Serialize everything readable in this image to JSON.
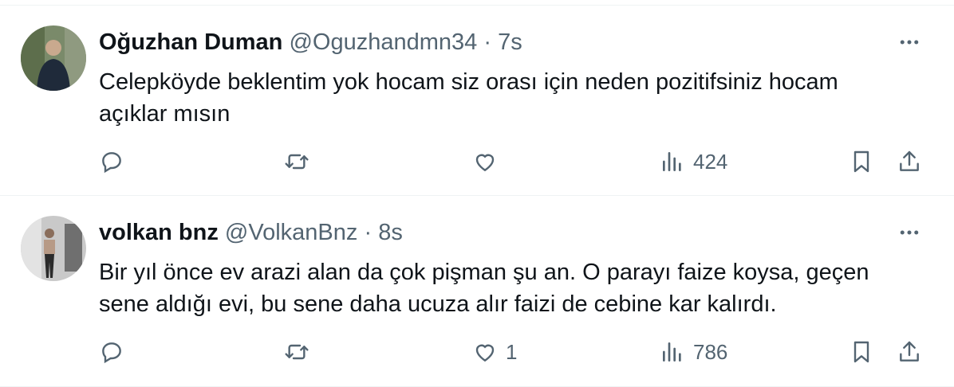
{
  "tweets": [
    {
      "name": "Oğuzhan Duman",
      "handle": "@Oguzhandmn34",
      "separator": "·",
      "time": "7s",
      "text": "Celepköyde beklentim yok hocam siz orası için neden pozitifsiniz hocam açıklar mısın",
      "likes": "",
      "views": "424"
    },
    {
      "name": "volkan bnz",
      "handle": "@VolkanBnz",
      "separator": "·",
      "time": "8s",
      "text": "Bir yıl önce ev arazi alan da çok pişman şu an. O parayı faize koysa, geçen sene aldığı evi, bu sene daha ucuza alır faizi de cebine kar kalırdı.",
      "likes": "1",
      "views": "786"
    }
  ],
  "icons": {
    "reply": "reply-icon",
    "retweet": "retweet-icon",
    "like": "heart-icon",
    "views": "views-icon",
    "bookmark": "bookmark-icon",
    "share": "share-icon",
    "more": "more-icon"
  },
  "colors": {
    "text": "#0f1419",
    "secondary": "#536471",
    "divider": "#eff3f4"
  }
}
